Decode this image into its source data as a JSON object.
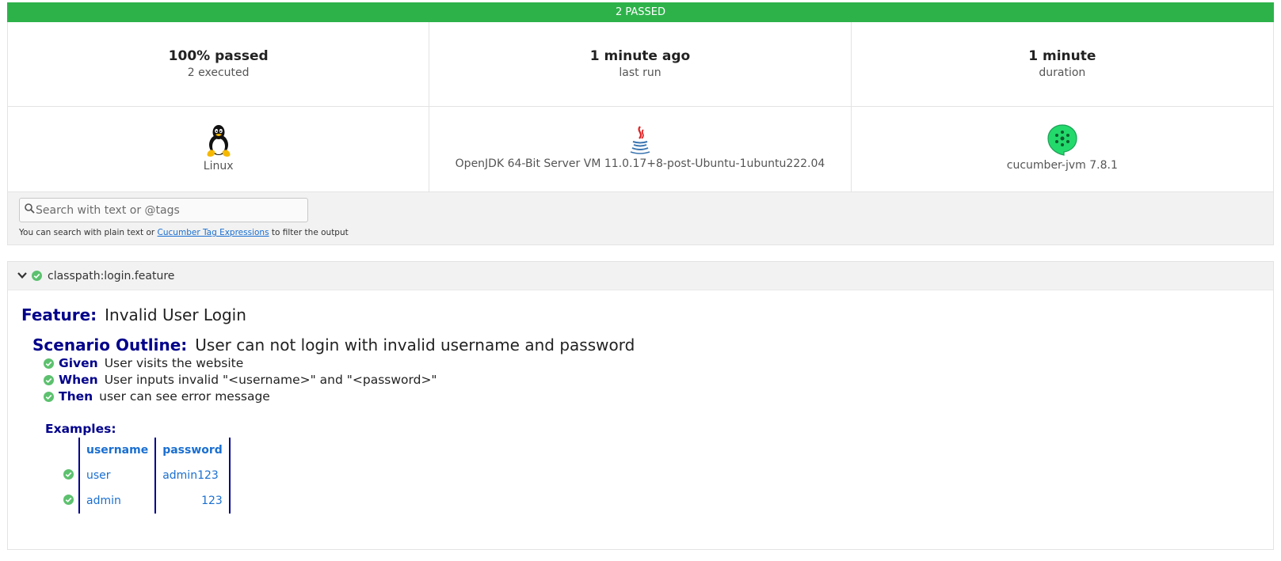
{
  "banner": {
    "text": "2 PASSED"
  },
  "colors": {
    "passed": "#2db24a",
    "keyword": "#00008b",
    "link": "#1a6fd1"
  },
  "summary": {
    "passed": {
      "main": "100% passed",
      "sub": "2 executed"
    },
    "last_run": {
      "main": "1 minute ago",
      "sub": "last run"
    },
    "duration": {
      "main": "1 minute",
      "sub": "duration"
    }
  },
  "environment": {
    "os": {
      "icon": "linux-tux-icon",
      "label": "Linux"
    },
    "runtime": {
      "icon": "java-icon",
      "label": "OpenJDK 64-Bit Server VM 11.0.17+8-post-Ubuntu-1ubuntu222.04"
    },
    "tool": {
      "icon": "cucumber-icon",
      "label": "cucumber-jvm 7.8.1"
    }
  },
  "search": {
    "placeholder": "Search with text or @tags",
    "hint_prefix": "You can search with plain text or ",
    "hint_link": "Cucumber Tag Expressions",
    "hint_suffix": " to filter the output"
  },
  "feature": {
    "uri": "classpath:login.feature",
    "keyword": "Feature:",
    "name": "Invalid User Login",
    "scenario": {
      "keyword": "Scenario Outline:",
      "name": "User can not login with invalid username and password",
      "steps": [
        {
          "keyword": "Given",
          "text": "User visits the website",
          "status": "passed"
        },
        {
          "keyword": "When",
          "text": "User inputs invalid \"<username>\" and \"<password>\"",
          "status": "passed"
        },
        {
          "keyword": "Then",
          "text": "user can see error message",
          "status": "passed"
        }
      ],
      "examples": {
        "keyword": "Examples:",
        "headers": [
          "username",
          "password"
        ],
        "rows": [
          {
            "status": "passed",
            "cells": [
              "user",
              "admin123"
            ]
          },
          {
            "status": "passed",
            "cells": [
              "admin",
              "123"
            ]
          }
        ]
      }
    }
  }
}
